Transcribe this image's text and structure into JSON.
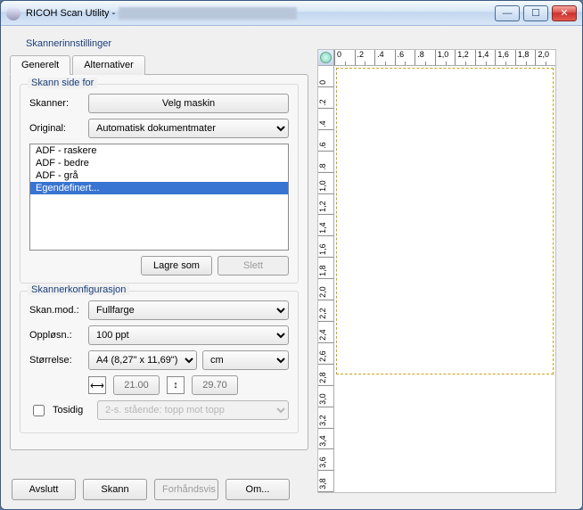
{
  "window": {
    "title": "RICOH Scan Utility - ",
    "buttons": {
      "min": "—",
      "max": "☐",
      "close": "✕"
    }
  },
  "settings_label": "Skannerinnstillinger",
  "tabs": {
    "general": "Generelt",
    "alt": "Alternativer"
  },
  "scan_side": {
    "legend": "Skann side for",
    "scanner_label": "Skanner:",
    "select_machine": "Velg maskin",
    "original_label": "Original:",
    "original_value": "Automatisk dokumentmater",
    "presets": [
      "ADF - raskere",
      "ADF - bedre",
      "ADF - grå",
      "Egendefinert..."
    ],
    "save_as": "Lagre som",
    "delete": "Slett"
  },
  "config": {
    "legend": "Skannerkonfigurasjon",
    "mode_label": "Skan.mod.:",
    "mode_value": "Fullfarge",
    "res_label": "Oppløsn.:",
    "res_value": "100 ppt",
    "size_label": "Størrelse:",
    "size_value": "A4 (8,27\" x 11,69\")",
    "unit_value": "cm",
    "width_value": "21.00",
    "height_value": "29.70",
    "duplex_label": "Tosidig",
    "duplex_mode": "2-s. stående: topp mot topp"
  },
  "footer": {
    "quit": "Avslutt",
    "scan": "Skann",
    "preview": "Forhåndsvis",
    "about": "Om..."
  },
  "ruler": {
    "h": [
      "0",
      ".2",
      ".4",
      ".6",
      ".8",
      "1,0",
      "1,2",
      "1,4",
      "1,6",
      "1,8",
      "2,0"
    ],
    "v": [
      "0",
      ".2",
      ".4",
      ".6",
      ".8",
      "1,0",
      "1,2",
      "1,4",
      "1,6",
      "1,8",
      "2,0",
      "2,2",
      "2,4",
      "2,6",
      "2,8",
      "3,0",
      "3,2",
      "3,4",
      "3,6",
      "3,8"
    ]
  }
}
